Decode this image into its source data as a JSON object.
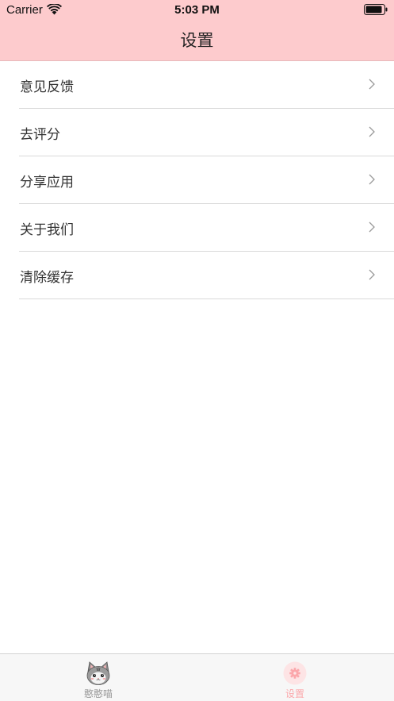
{
  "status_bar": {
    "carrier": "Carrier",
    "time": "5:03 PM"
  },
  "nav": {
    "title": "设置"
  },
  "settings": {
    "items": [
      {
        "label": "意见反馈"
      },
      {
        "label": "去评分"
      },
      {
        "label": "分享应用"
      },
      {
        "label": "关于我们"
      },
      {
        "label": "清除缓存"
      }
    ]
  },
  "tabbar": {
    "tabs": [
      {
        "label": "憨憨喵",
        "icon": "cat-face-icon",
        "active": false
      },
      {
        "label": "设置",
        "icon": "gear-icon",
        "active": true
      }
    ]
  },
  "colors": {
    "header_background": "#fdcbcd",
    "active_tab": "#fba7ab",
    "inactive_tab": "#999999"
  }
}
